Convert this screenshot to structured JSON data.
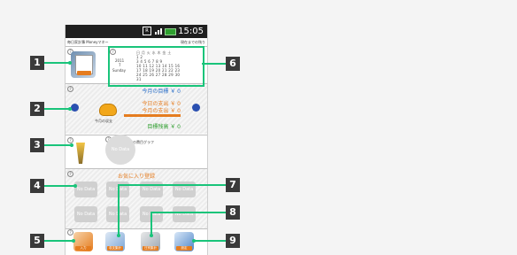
{
  "status": {
    "time": "15:05"
  },
  "app": {
    "title_left": "毎日家計簿 Moneyマネー",
    "title_right": "現在までの残り"
  },
  "calendar": {
    "year": "2011",
    "month": "7",
    "weekday": "Sunday",
    "weekday_headers": "日 月 火 水 木 金 土",
    "rows": [
      "           1  2",
      " 3  4  5  6  7  8  9",
      "10 11 12 13 14 15 16",
      "17 18 19 20 21 22 23",
      "24 25 26 27 28 29 30",
      "31"
    ]
  },
  "budget": {
    "monthly_target": "今月の目標 ￥ 0",
    "today_expense": "今日の支出 ￥ 0",
    "month_expense": "今月の支出 ￥ 0",
    "remaining": "目標残高 ￥ 0",
    "wallet_label": "今月の収支"
  },
  "graph": {
    "title": "今月の費目グラフ",
    "no_data": "No Data"
  },
  "favorites": {
    "title": "お気に入り登録",
    "items": [
      "No Data",
      "No Data",
      "No Data",
      "No Data",
      "No Data",
      "No Data",
      "No Data",
      "No Data"
    ]
  },
  "dock": {
    "items": [
      "入力",
      "収支集計",
      "日別集計",
      "設定"
    ]
  },
  "callouts": [
    "1",
    "2",
    "3",
    "4",
    "5",
    "6",
    "7",
    "8",
    "9"
  ],
  "colors": {
    "accent_green": "#19c47a",
    "orange": "#e57c1f",
    "blue_text": "#2a6fc9",
    "green_text": "#2e9e2e"
  }
}
